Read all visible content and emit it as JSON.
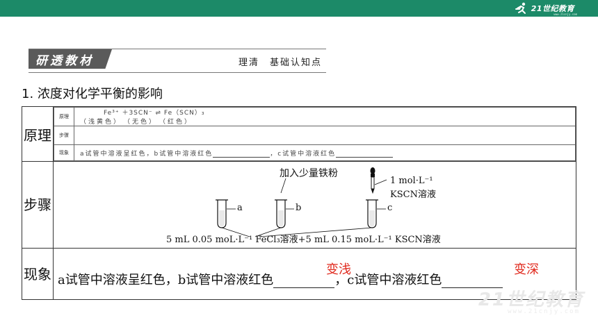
{
  "header": {
    "logo_text": "21世纪教育",
    "logo_sub": "www.21cnjy.com",
    "bar_color": "#1c8a68"
  },
  "section": {
    "banner": "研透教材",
    "subtitle": "理清　基础认知点"
  },
  "heading": "1. 浓度对化学平衡的影响",
  "table": {
    "rows": [
      {
        "label": "原理"
      },
      {
        "label": "步骤"
      },
      {
        "label": "现象"
      }
    ],
    "inner": {
      "rows": [
        {
          "label": "原理",
          "line1": "Fe³⁺ ＋3SCN⁻ ⇌ Fe（SCN）₃",
          "line2": "（浅黄色）　（无色）　（红色）"
        },
        {
          "label": "步骤",
          "line1": ""
        },
        {
          "label": "现象",
          "text_a": "a试管中溶液呈红色，b试管中溶液红色",
          "text_b": "，c试管中溶液红色"
        }
      ]
    },
    "diagram": {
      "iron_label": "加入少量铁粉",
      "kscn_conc": "1 mol·L⁻¹",
      "kscn_name": "KSCN溶液",
      "tube_a": "a",
      "tube_b": "b",
      "tube_c": "c",
      "bottom_label": "5 mL 0.05 moL·L⁻¹ FeCl₃溶液+5 mL 0.15 moL·L⁻¹ KSCN溶液"
    },
    "phenomenon": {
      "text_a": "a试管中溶液呈红色，b试管中溶液红色",
      "text_b": "，c试管中溶液红色",
      "answer_b": "变浅",
      "answer_c": "变深",
      "answer_color": "#e0281c"
    }
  },
  "watermark": {
    "main": "21世纪教育",
    "sub": "www.21cnjy.com"
  }
}
